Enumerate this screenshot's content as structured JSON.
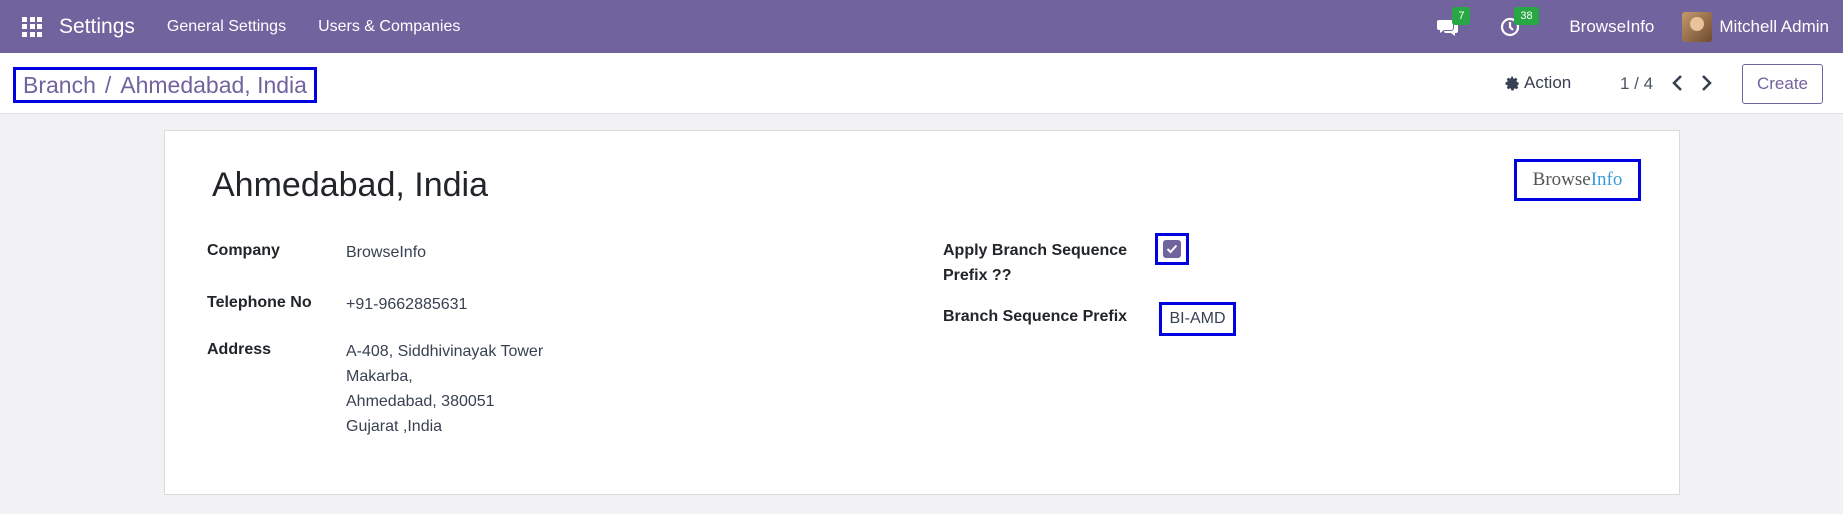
{
  "navbar": {
    "app_name": "Settings",
    "menus": [
      "General Settings",
      "Users & Companies"
    ],
    "messages_count": "7",
    "activities_count": "38",
    "company": "BrowseInfo",
    "user": "Mitchell Admin",
    "color": "#71639e"
  },
  "breadcrumb": {
    "parent": "Branch",
    "separator": "/",
    "current": "Ahmedabad, India"
  },
  "toolbar": {
    "action_label": "Action",
    "pager": "1 / 4",
    "create_label": "Create"
  },
  "form": {
    "title": "Ahmedabad, India",
    "logo": {
      "part1": "Browse",
      "part2": "Info"
    },
    "company_label": "Company",
    "company_value": "BrowseInfo",
    "telephone_label": "Telephone No",
    "telephone_value": "+91-9662885631",
    "address_label": "Address",
    "address_lines": [
      "A-408, Siddhivinayak Tower",
      "Makarba,",
      "Ahmedabad, 380051",
      "Gujarat ,India"
    ],
    "apply_prefix_label_1": "Apply Branch Sequence",
    "apply_prefix_label_2": "Prefix ??",
    "apply_prefix_checked": true,
    "sequence_prefix_label": "Branch Sequence Prefix",
    "sequence_prefix_value": "BI-AMD"
  }
}
